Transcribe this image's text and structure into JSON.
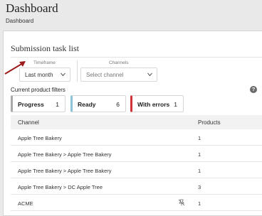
{
  "header": {
    "title": "Dashboard",
    "breadcrumb": "Dashboard"
  },
  "card": {
    "title": "Submission task list"
  },
  "filters": {
    "timeframe": {
      "label": "Timeframe",
      "value": "Last month"
    },
    "channels": {
      "label": "Channels",
      "placeholder": "Select channel"
    }
  },
  "product_filters": {
    "heading": "Current product filters",
    "help_icon": "?",
    "chips": [
      {
        "name": "Progress",
        "count": "1",
        "color": "#a9a9a9"
      },
      {
        "name": "Ready",
        "count": "6",
        "color": "#8fc3d9"
      },
      {
        "name": "With errors",
        "count": "1",
        "color": "#d13438"
      }
    ]
  },
  "table": {
    "columns": [
      "Channel",
      "Products"
    ],
    "rows": [
      {
        "channel": "Apple Tree Bakery",
        "products": "1"
      },
      {
        "channel": "Apple Tree Bakery > Apple Tree Bakery",
        "products": "1"
      },
      {
        "channel": "Apple Tree Bakery > Apple Tree Bakery",
        "products": "1"
      },
      {
        "channel": "Apple Tree Bakery > DC Apple Tree",
        "products": "3"
      },
      {
        "channel": "ACME",
        "products": "1",
        "icon": "unpin-icon"
      }
    ]
  },
  "colors": {
    "annotation_arrow": "#9b1c1c"
  }
}
